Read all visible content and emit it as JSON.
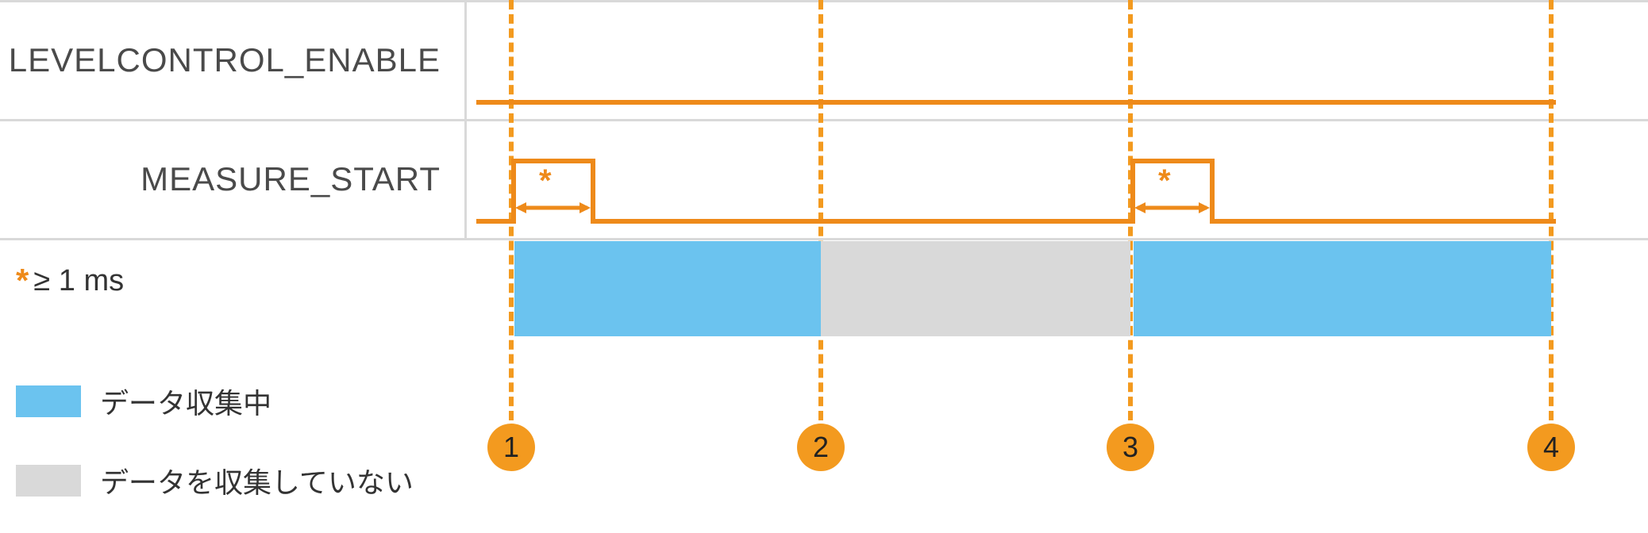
{
  "colors": {
    "accent": "#ee8a1a",
    "dash": "#f39a1f",
    "blue": "#6bc3ef",
    "gray": "#d9d9d9"
  },
  "rows": {
    "row1_label": "LEVELCONTROL_ENABLE",
    "row2_label": "MEASURE_START"
  },
  "pulse_annotation": "*",
  "note": {
    "star": "*",
    "text": "≥ 1 ms"
  },
  "legend": {
    "collecting": "データ収集中",
    "not_collecting": "データを収集していない"
  },
  "markers": [
    "1",
    "2",
    "3",
    "4"
  ],
  "chart_data": {
    "type": "timing-diagram",
    "time_axis_markers": [
      1,
      2,
      3,
      4
    ],
    "signals": [
      {
        "name": "LEVELCONTROL_ENABLE",
        "segments": [
          {
            "from": "start",
            "to": 1,
            "level": "low"
          },
          {
            "from": 1,
            "to": "end",
            "level": "high"
          }
        ]
      },
      {
        "name": "MEASURE_START",
        "segments": [
          {
            "from": "start",
            "to": 1,
            "level": "low"
          },
          {
            "from": 1,
            "to": "1+pulse",
            "level": "high",
            "min_duration": "1 ms"
          },
          {
            "from": "1+pulse",
            "to": 3,
            "level": "low"
          },
          {
            "from": 3,
            "to": "3+pulse",
            "level": "high",
            "min_duration": "1 ms"
          },
          {
            "from": "3+pulse",
            "to": "end",
            "level": "low"
          }
        ]
      }
    ],
    "data_collection_intervals": [
      {
        "from": 1,
        "to": 2,
        "state": "collecting"
      },
      {
        "from": 2,
        "to": 3,
        "state": "not_collecting"
      },
      {
        "from": 3,
        "to": 4,
        "state": "collecting"
      }
    ],
    "pulse_width_note": "≥ 1 ms",
    "legend": {
      "collecting": "データ収集中",
      "not_collecting": "データを収集していない"
    }
  }
}
